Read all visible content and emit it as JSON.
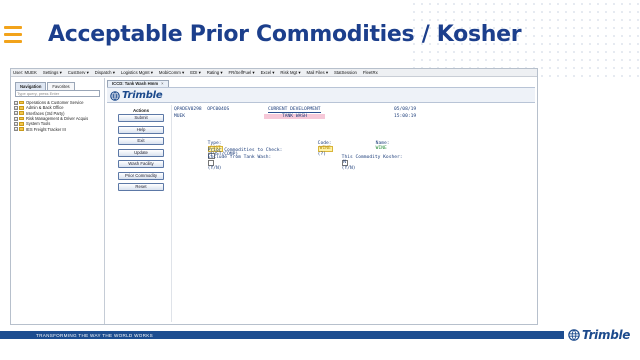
{
  "slide": {
    "title": "Acceptable Prior Commodities / Kosher",
    "footer": "TRANSFORMING THE WAY THE WORLD WORKS",
    "brand": "Trimble",
    "colors": {
      "title": "#1c3f8c",
      "accent": "#f2a31b",
      "footer": "#1d4d90"
    }
  },
  "app": {
    "menubar": {
      "user": "User: MUEK",
      "items": [
        "Settings ▾",
        "CustServ ▾",
        "Dispatch ▾",
        "Logistics Mgmt ▾",
        "MobiComm ▾",
        "EDI ▾",
        "Rating ▾",
        "FR/SelfFuel ▾",
        "Excel ▾",
        "Risk Mgt ▾",
        "Mail Files ▾",
        "StatSession",
        "FleetRx"
      ]
    },
    "nav": {
      "tabs": [
        "Navigation",
        "Favorites"
      ],
      "search_placeholder": "Type query, press Enter",
      "tree": [
        "Operations & Customer Service",
        "Admin & Back Office",
        "Interfaces (3rd Party)",
        "Risk Management & Driver Acquis",
        "System Tools",
        "IES Freight Tracker III"
      ]
    },
    "doc_tab": "ICCD: Tank Wash Hmm",
    "doc_tab_close": "×",
    "logo": "Trimble",
    "actions": {
      "header": "Actions",
      "buttons": [
        "Submit",
        "Help",
        "Exit",
        "Update",
        "Wash Facility",
        "Prior Commodity",
        "Reset"
      ]
    },
    "screen": {
      "line1_left": "QPADEV0298  OPC004OS",
      "line1_center": "CURRENT DEVELOPMENT",
      "line1_right": "05/08/19",
      "line2_left": "MUEK",
      "line2_center": "TANK WASH",
      "line2_right": "15:00:19",
      "type_label": "Type:",
      "type_value": "CUST",
      "type_hint": "(CUST/COMP)",
      "code_label": "Code:",
      "code_value": "WINE",
      "code_hint": "(?)",
      "name_label": "Name:",
      "name_value": "WINE",
      "prior_label": "Prior Commodities to Check:",
      "prior_value": "1",
      "exclude_label": "Exclude from Tank Wash:",
      "exclude_hint": "(Y/N)",
      "kosher_label": "This Commodity Kosher:",
      "kosher_value": "N",
      "kosher_hint": "(Y/N)"
    }
  }
}
